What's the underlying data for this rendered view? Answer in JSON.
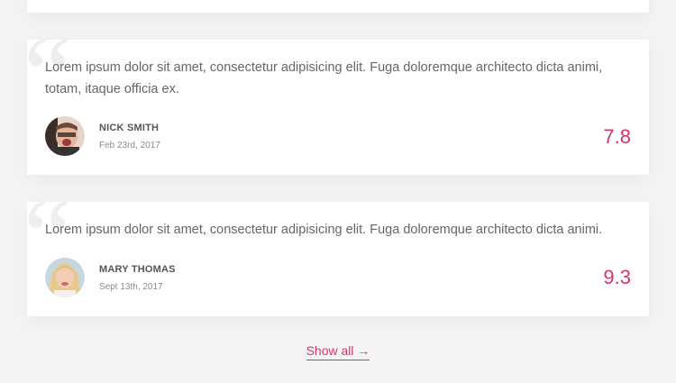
{
  "reviews": [
    {
      "text": "Lorem ipsum dolor sit amet, consectetur adipisicing elit. Fuga doloremque architecto dicta animi, totam, itaque officia ex.",
      "author": "NICK SMITH",
      "date": "Feb 23rd, 2017",
      "score": "7.8"
    },
    {
      "text": "Lorem ipsum dolor sit amet, consectetur adipisicing elit. Fuga doloremque architecto dicta animi.",
      "author": "MARY THOMAS",
      "date": "Sept 13th, 2017",
      "score": "9.3"
    }
  ],
  "quote_glyph": "“",
  "show_all": {
    "label": "Show all",
    "arrow": "→"
  },
  "colors": {
    "accent": "#d6346a",
    "background": "#f4f4f4",
    "card": "#ffffff",
    "text": "#666666"
  }
}
